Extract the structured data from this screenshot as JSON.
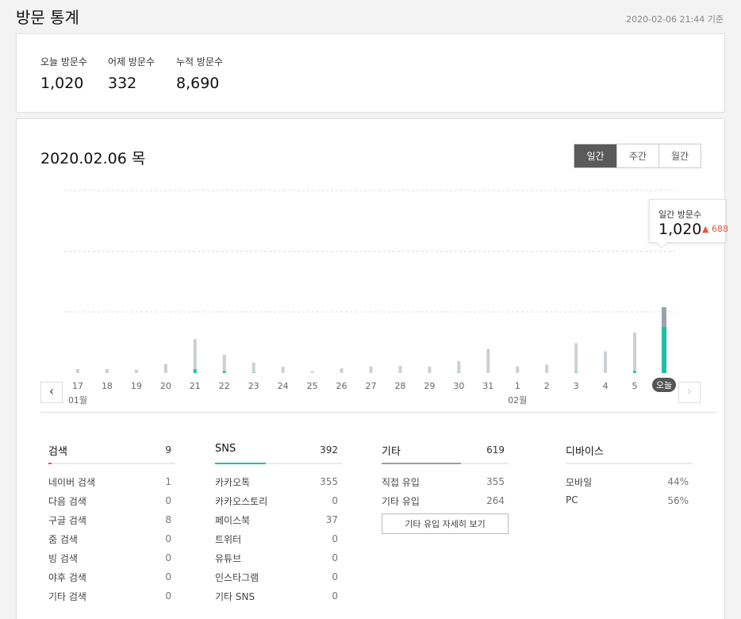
{
  "header": {
    "title": "방문 통계",
    "timestamp": "2020-02-06 21:44 기준"
  },
  "summary": [
    {
      "label": "오늘 방문수",
      "value": "1,020"
    },
    {
      "label": "어제 방문수",
      "value": "332"
    },
    {
      "label": "누적 방문수",
      "value": "8,690"
    }
  ],
  "main": {
    "date_title": "2020.02.06 목",
    "tabs": [
      {
        "label": "일간"
      },
      {
        "label": "주간"
      },
      {
        "label": "월간"
      }
    ],
    "active_tab": "일간",
    "nav": {
      "prev": "‹",
      "next": "›"
    }
  },
  "tooltip": {
    "label": "일간 방문수",
    "value": "1,020",
    "delta": "▲ 688"
  },
  "chart_data": {
    "type": "bar",
    "stacked": true,
    "grid": true,
    "x": [
      "17",
      "18",
      "19",
      "20",
      "21",
      "22",
      "23",
      "24",
      "25",
      "26",
      "27",
      "28",
      "29",
      "30",
      "31",
      "1",
      "2",
      "3",
      "4",
      "5",
      "오늘"
    ],
    "month_labels": [
      {
        "label": "01월",
        "under": "17"
      },
      {
        "label": "02월",
        "under": "1"
      }
    ],
    "highlight": "오늘",
    "series": [
      {
        "color": "#1fbfa5",
        "values": [
          0,
          0,
          0,
          0,
          60,
          30,
          8,
          0,
          0,
          0,
          0,
          0,
          0,
          5,
          0,
          0,
          0,
          8,
          0,
          30,
          710
        ]
      },
      {
        "color": "#ccd0d3",
        "values": [
          60,
          60,
          50,
          140,
          460,
          250,
          150,
          95,
          25,
          70,
          100,
          110,
          100,
          180,
          370,
          100,
          130,
          450,
          330,
          590,
          300
        ]
      }
    ],
    "highlight_color": "#9aa3ab",
    "ylim": [
      0,
      2800
    ]
  },
  "sections": [
    {
      "title": "검색",
      "total": "9",
      "bar_color": "#e8563e",
      "items": [
        {
          "label": "네이버 검색",
          "value": "1"
        },
        {
          "label": "다음 검색",
          "value": "0"
        },
        {
          "label": "구글 검색",
          "value": "8"
        },
        {
          "label": "줌 검색",
          "value": "0"
        },
        {
          "label": "빙 검색",
          "value": "0"
        },
        {
          "label": "야후 검색",
          "value": "0"
        },
        {
          "label": "기타 검색",
          "value": "0"
        }
      ]
    },
    {
      "title": "SNS",
      "total": "392",
      "bar_color": "#1fbfa5",
      "items": [
        {
          "label": "카카오톡",
          "value": "355"
        },
        {
          "label": "카카오스토리",
          "value": "0"
        },
        {
          "label": "페이스북",
          "value": "37"
        },
        {
          "label": "트위터",
          "value": "0"
        },
        {
          "label": "유튜브",
          "value": "0"
        },
        {
          "label": "인스타그램",
          "value": "0"
        },
        {
          "label": "기타 SNS",
          "value": "0"
        }
      ]
    },
    {
      "title": "기타",
      "total": "619",
      "bar_color": "#9aa3ab",
      "items": [
        {
          "label": "직접 유입",
          "value": "355"
        },
        {
          "label": "기타 유입",
          "value": "264"
        }
      ],
      "more_label": "기타 유입 자세히 보기"
    },
    {
      "title": "디바이스",
      "total": "",
      "bar_color": "#e9e9e9",
      "items": [
        {
          "label": "모바일",
          "value": "44%"
        },
        {
          "label": "PC",
          "value": "56%"
        }
      ]
    }
  ]
}
